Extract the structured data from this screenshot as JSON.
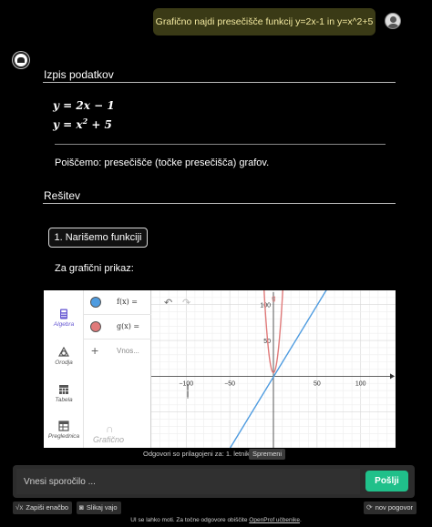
{
  "user_message": "Grafično najdi presečišče funkcij y=2x-1 in y=x^2+5",
  "sections": {
    "data_heading": "Izpis podatkov",
    "solution_heading": "Rešitev"
  },
  "equations": [
    {
      "lhs": "y",
      "rhs": "2x − 1"
    },
    {
      "lhs": "y",
      "rhs_base": "x",
      "rhs_exp": "2",
      "rhs_rest": " + 5"
    }
  ],
  "task_text": "Poiščemo: presečišče (točke presečišča) grafov.",
  "step_button": "1. Narišemo funkciji",
  "graph_intro": "Za grafični prikaz:",
  "geogebra": {
    "tools": [
      "Algebra",
      "Orodja",
      "Tabela",
      "Preglednica"
    ],
    "active_tool": "Algebra",
    "algebra_rows": [
      {
        "label": "f(x) =",
        "color": "#4f9ce0"
      },
      {
        "label": "g(x) =",
        "color": "#e07a7a"
      }
    ],
    "input_placeholder": "Vnos...",
    "logo_text": "Grafično",
    "undo_icon": "undo-icon",
    "redo_icon": "redo-icon"
  },
  "chart_data": {
    "type": "line",
    "series": [
      {
        "name": "f",
        "expression": "2x-1",
        "color": "#4f9ce0"
      },
      {
        "name": "g",
        "expression": "x^2+5",
        "color": "#e07a7a"
      }
    ],
    "xlim": [
      -140,
      140
    ],
    "ylim": [
      -100,
      120
    ],
    "x_ticks": [
      -100,
      -50,
      50,
      100
    ],
    "y_ticks": [
      100,
      50
    ],
    "grid": true
  },
  "caption": {
    "text": "Odgovori so prilagojeni za: 1. letnik",
    "change_label": "Spremeni"
  },
  "composer": {
    "placeholder": "Vnesi sporočilo ...",
    "send_label": "Pošlji"
  },
  "tools": {
    "formula_label": "Zapiši enačbo",
    "photo_label": "Slikaj vajo",
    "new_chat_label": "nov pogovor"
  },
  "footer": {
    "text": "UI se lahko moti. Za točne odgovore obiščite ",
    "link": "OpenProf učbenike",
    "end": "."
  }
}
